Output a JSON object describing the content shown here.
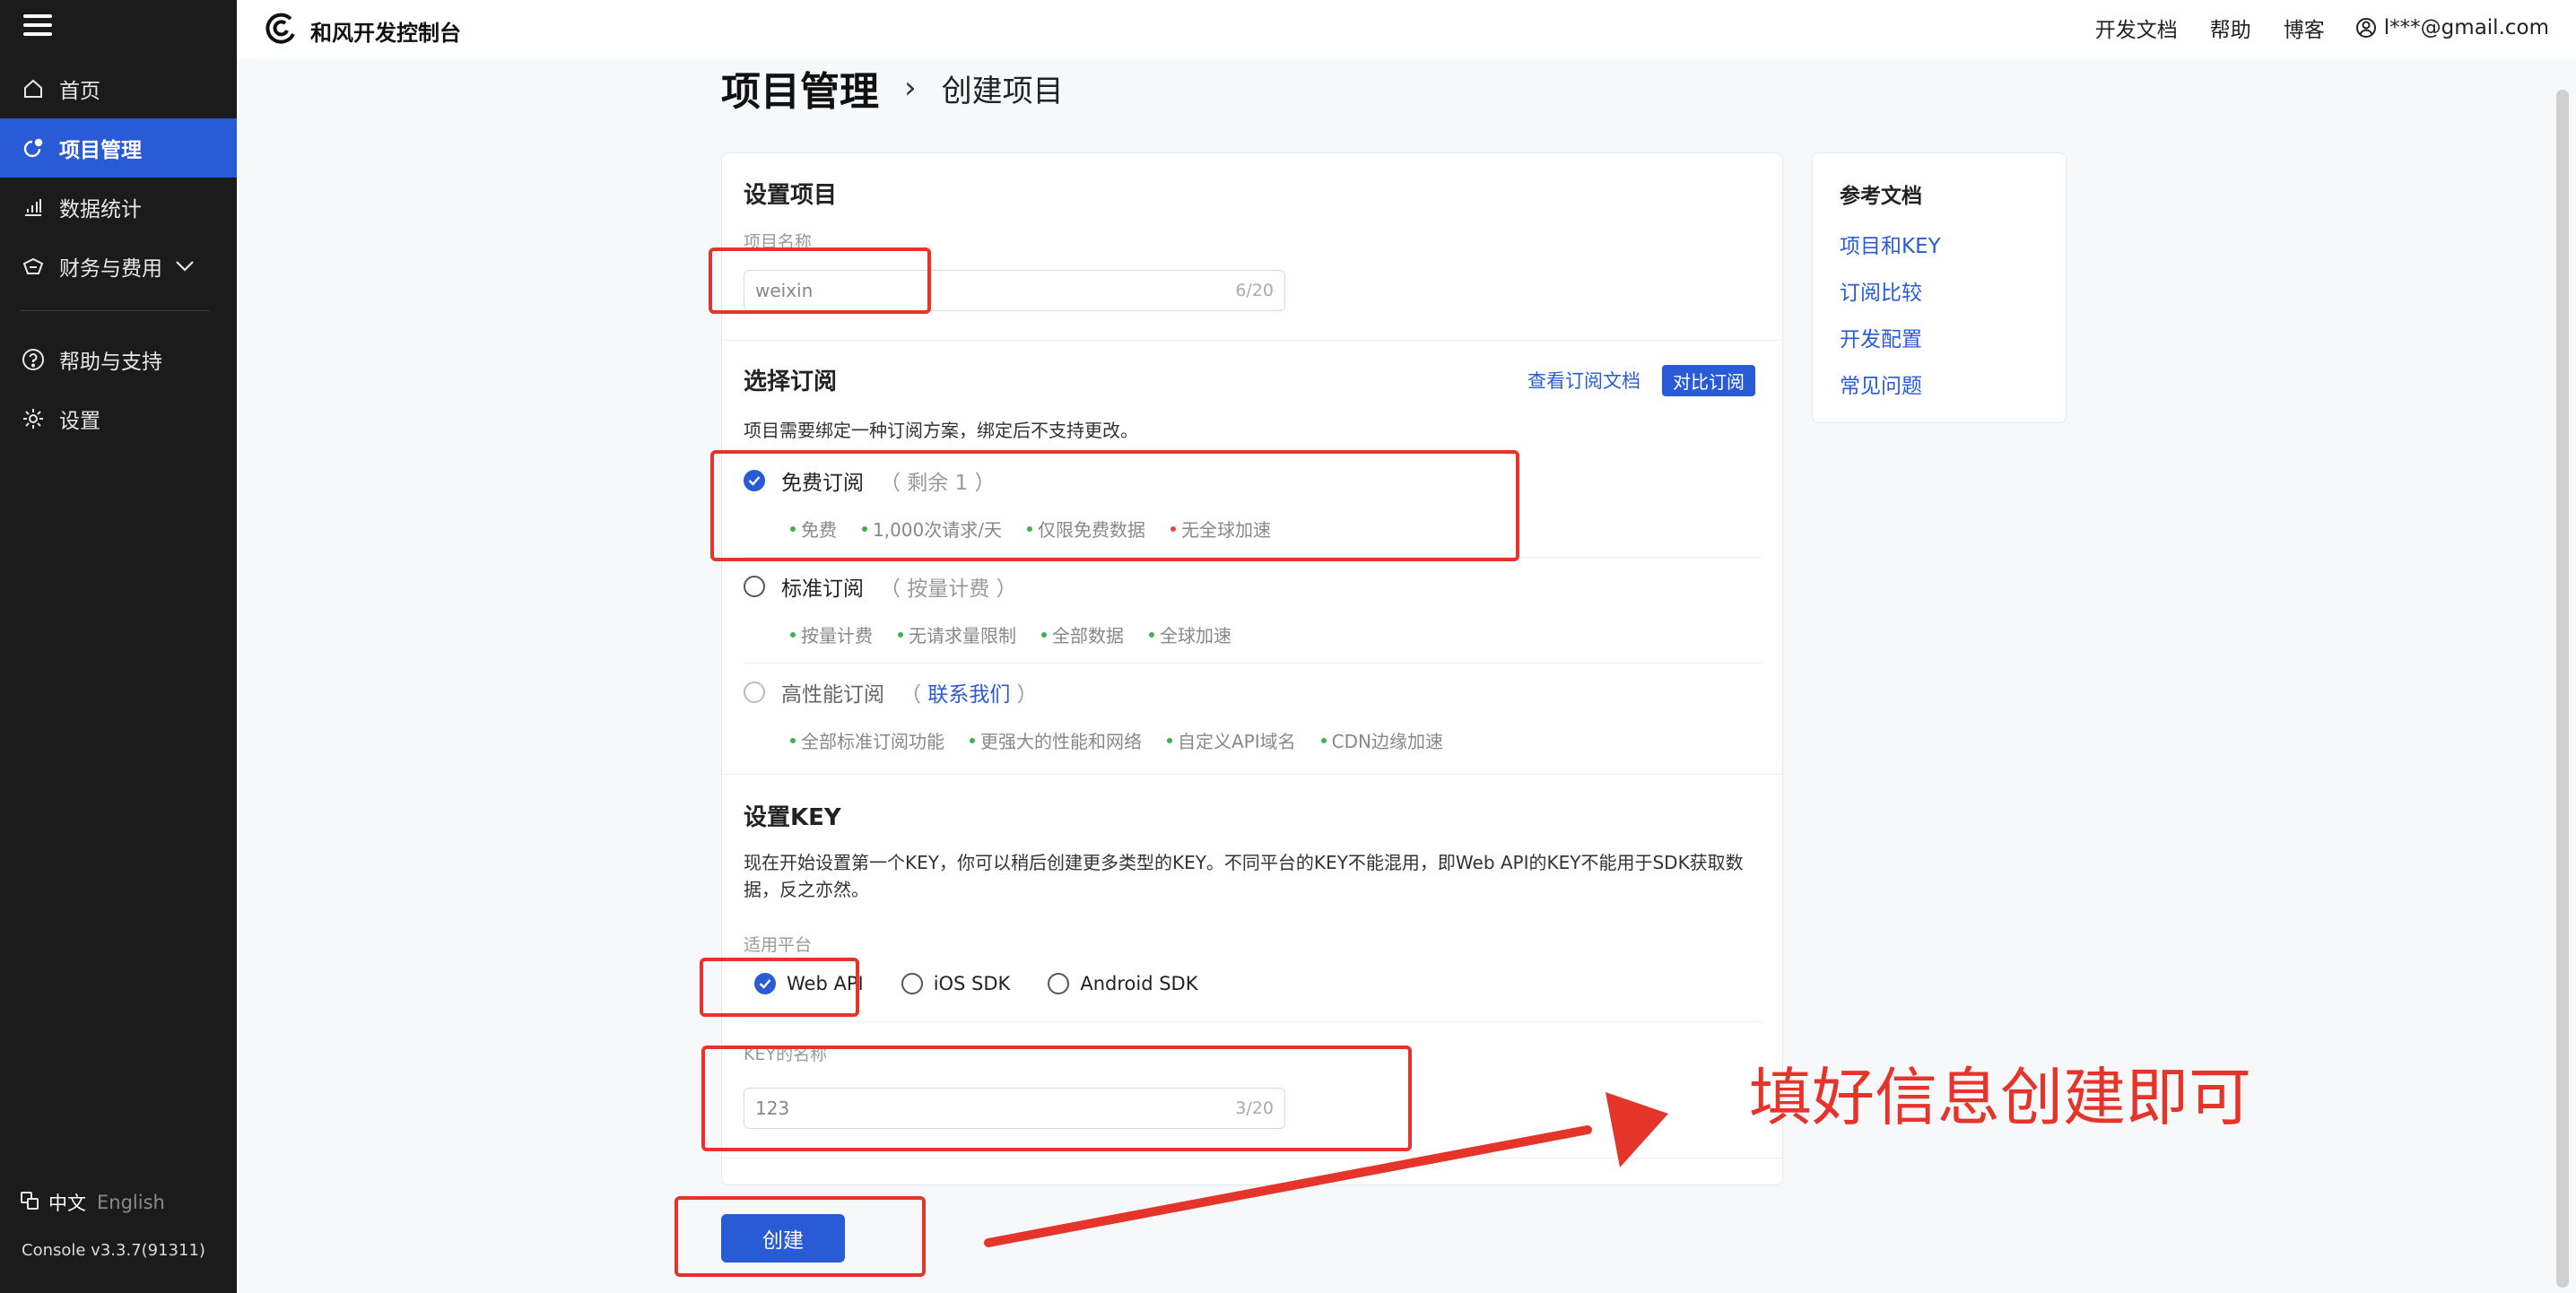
{
  "sidebar": {
    "items": [
      {
        "label": "首页",
        "icon": "home-icon"
      },
      {
        "label": "项目管理",
        "icon": "project-icon",
        "active": true
      },
      {
        "label": "数据统计",
        "icon": "bar-chart-icon"
      },
      {
        "label": "财务与费用",
        "icon": "wallet-icon"
      },
      {
        "label": "帮助与支持",
        "icon": "help-icon"
      },
      {
        "label": "设置",
        "icon": "gear-icon"
      }
    ],
    "lang_cn": "中文",
    "lang_en": "English",
    "version": "Console v3.3.7(91311)"
  },
  "header": {
    "brand": "和风开发控制台",
    "links": [
      "开发文档",
      "帮助",
      "博客"
    ],
    "user": "l***@gmail.com"
  },
  "breadcrumb": {
    "main": "项目管理",
    "sep": "›",
    "sub": "创建项目"
  },
  "form": {
    "project_section": "设置项目",
    "project_name_label": "项目名称",
    "project_name_value": "weixin",
    "project_name_count": "6/20",
    "sub_section": "选择订阅",
    "view_docs": "查看订阅文档",
    "compare": "对比订阅",
    "sub_desc": "项目需要绑定一种订阅方案，绑定后不支持更改。",
    "plans": [
      {
        "name": "免费订阅",
        "note": "（ 剩余 1 ）",
        "features": [
          "免费",
          "1,000次请求/天",
          "仅限免费数据"
        ],
        "bad_feature": "无全球加速"
      },
      {
        "name": "标准订阅",
        "note": "（ 按量计费 ）",
        "features": [
          "按量计费",
          "无请求量限制",
          "全部数据",
          "全球加速"
        ]
      },
      {
        "name": "高性能订阅",
        "note_pre": "（",
        "contact": "联系我们",
        "note_post": "）",
        "features": [
          "全部标准订阅功能",
          "更强大的性能和网络",
          "自定义API域名",
          "CDN边缘加速"
        ]
      }
    ],
    "key_section": "设置KEY",
    "key_desc": "现在开始设置第一个KEY，你可以稍后创建更多类型的KEY。不同平台的KEY不能混用，即Web API的KEY不能用于SDK获取数据，反之亦然。",
    "platform_label": "适用平台",
    "platforms": [
      "Web API",
      "iOS SDK",
      "Android SDK"
    ],
    "key_name_label": "KEY的名称",
    "key_name_value": "123",
    "key_name_count": "3/20",
    "create_label": "创建"
  },
  "docs": {
    "title": "参考文档",
    "links": [
      "项目和KEY",
      "订阅比较",
      "开发配置",
      "常见问题"
    ]
  },
  "annotation": {
    "text": "填好信息创建即可",
    "color": "#e5342a"
  },
  "colors": {
    "accent": "#2a5bd7",
    "sidebar_bg": "#1b1b1b",
    "feature_dot": "#3cb44a",
    "warn_dot": "#e5453b"
  }
}
